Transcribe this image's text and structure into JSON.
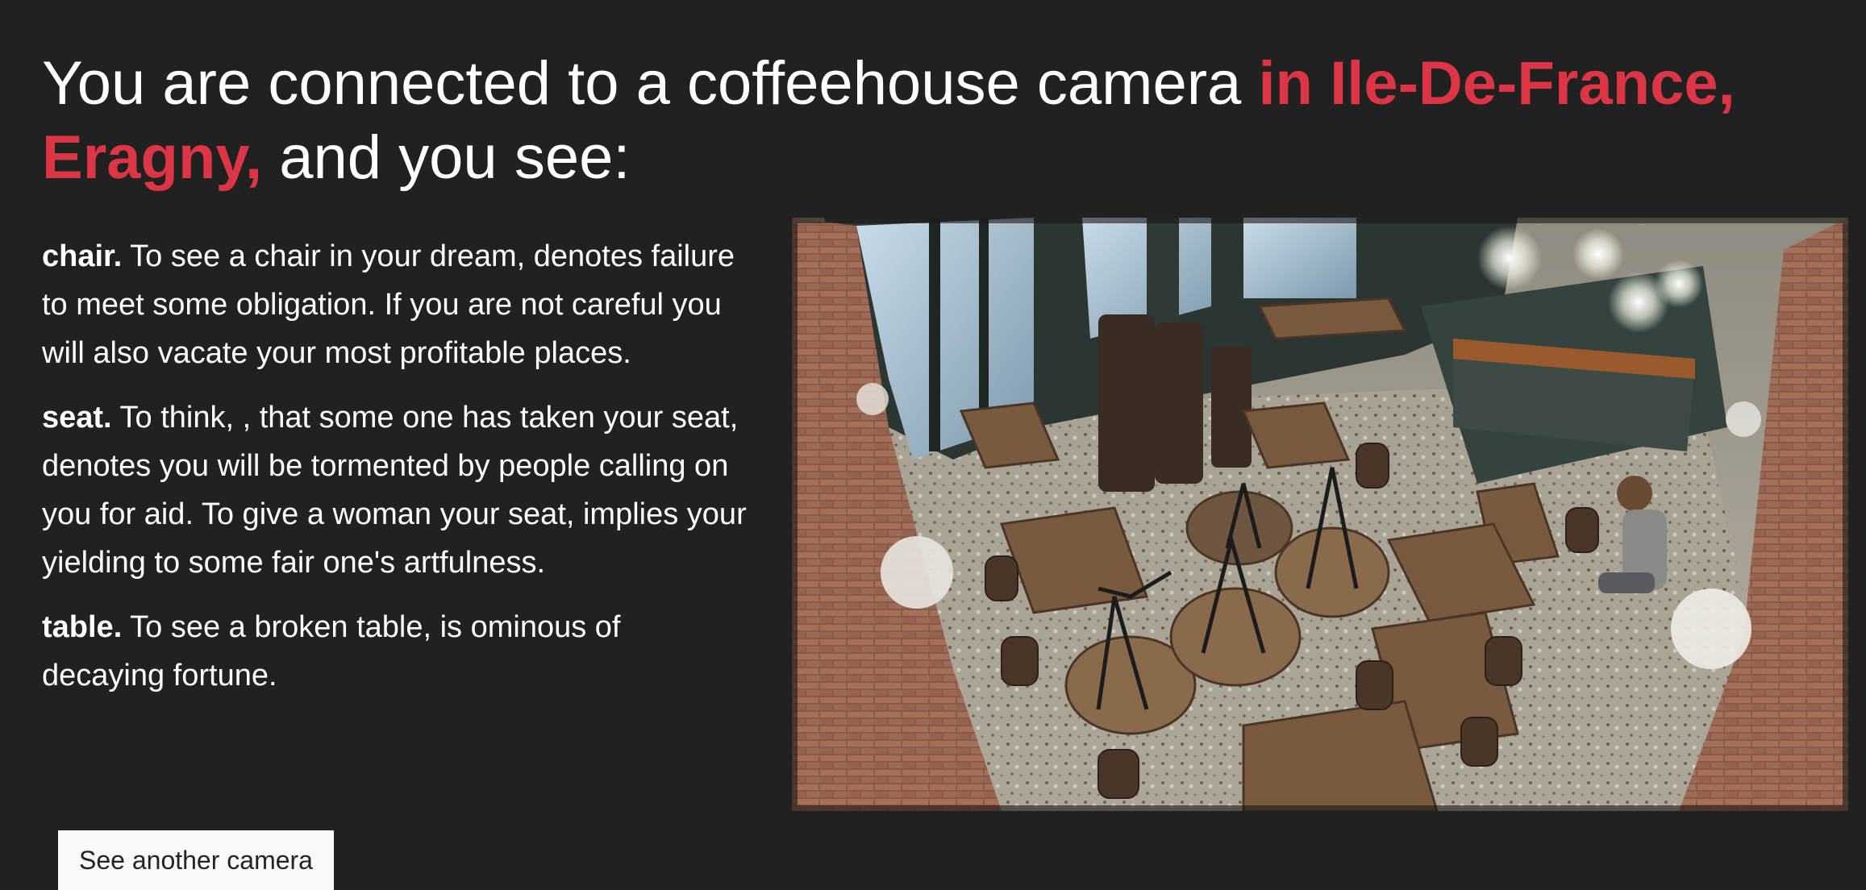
{
  "headline": {
    "prefix": "You are connected to a coffeehouse camera",
    "location": "in Ile-De-France, Eragny,",
    "suffix": "and you see:"
  },
  "descriptions": [
    {
      "term": "chair.",
      "text": "To see a chair in your dream, denotes failure to meet some obligation. If you are not careful you will also vacate your most profitable places."
    },
    {
      "term": "seat.",
      "text": "To think, , that some one has taken your seat, denotes you will be tormented by people calling on you for aid. To give a woman your seat, implies your yielding to some fair one's artfulness."
    },
    {
      "term": "table.",
      "text": "To see a broken table, is ominous of decaying fortune."
    }
  ],
  "camera": {
    "image_name": "coffeehouse-camera-feed"
  },
  "actions": {
    "see_another": "See another camera"
  },
  "colors": {
    "background": "#212121",
    "accent": "#dc3545",
    "text": "#ffffff",
    "button_bg": "#f8f9fa"
  }
}
